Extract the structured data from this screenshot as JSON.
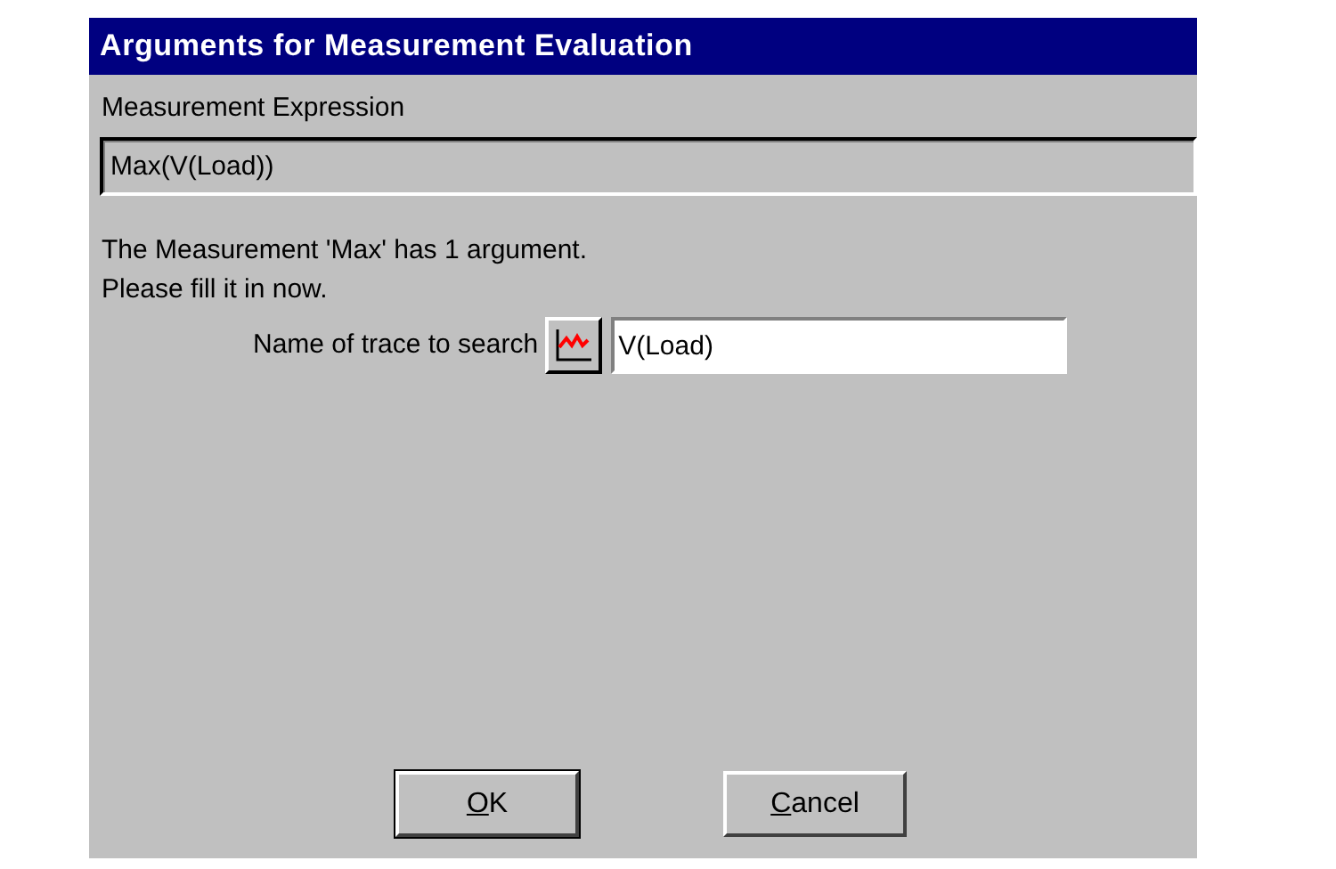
{
  "window": {
    "title": "Arguments for Measurement Evaluation"
  },
  "expression": {
    "label": "Measurement Expression",
    "value": "Max(V(Load))"
  },
  "message": [
    "The Measurement 'Max' has 1 argument.",
    "Please fill it in now."
  ],
  "argument": {
    "label": "Name of trace to search",
    "value": "V(Load)"
  },
  "buttons": [
    {
      "label": "OK",
      "mnemonic_underlined": true,
      "default": true
    },
    {
      "label": "Cancel",
      "mnemonic_underlined": true,
      "default": false
    }
  ]
}
